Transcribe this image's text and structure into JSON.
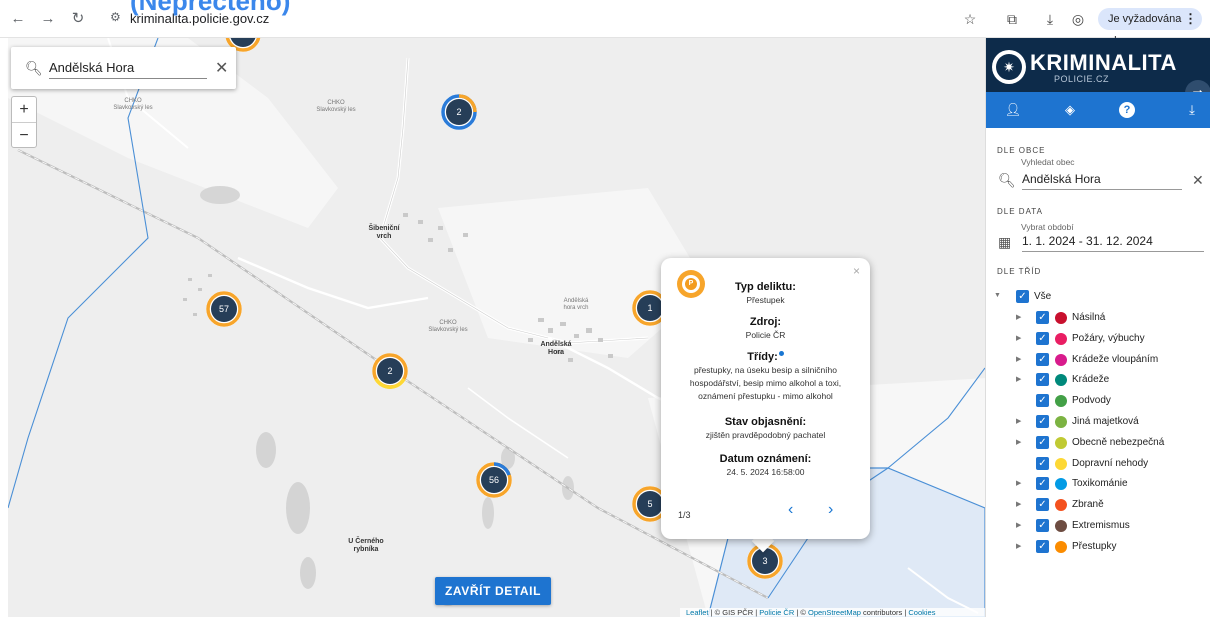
{
  "browser": {
    "url": "kriminalita.policie.gov.cz",
    "profile_chip": "Je vyžadována akce",
    "overlay_text": "(Nepřečteno)"
  },
  "map": {
    "search": {
      "value": "Andělská Hora",
      "placeholder": "Vyhledat obec"
    },
    "zoom_in": "+",
    "zoom_out": "−",
    "labels": {
      "chko_1": "CHKO Slavkovský les",
      "chko_2": "CHKO Slavkovský les",
      "chko_3": "CHKO Slavkovský les",
      "chko_4": "Andělská hora vrch",
      "sibenicni": "Šibeniční vrch",
      "andelska_hora": "Andělská Hora",
      "u_cerneho": "U Černého rybníka"
    },
    "clusters": [
      {
        "count": "2"
      },
      {
        "count": "57"
      },
      {
        "count": "2"
      },
      {
        "count": "1"
      },
      {
        "count": "56"
      },
      {
        "count": "5"
      },
      {
        "count": "3"
      }
    ],
    "close_detail": "ZAVŘÍT DETAIL",
    "attribution": {
      "leaflet": "Leaflet",
      "gis": "| © GIS PČR |",
      "policie": "Policie ČR",
      "osm_sep": "| ©",
      "osm": "OpenStreetMap",
      "contrib": "contributors |",
      "cookies": "Cookies"
    }
  },
  "popup": {
    "badge_letter": "P",
    "close": "×",
    "offense_heading": "Typ deliktu:",
    "offense_value": "Přestupek",
    "source_heading": "Zdroj:",
    "source_value": "Policie ČR",
    "classes_heading": "Třídy:",
    "classes_line1": "přestupky, na úseku besip a silničního",
    "classes_line2": "hospodářství, besip mimo alkohol a toxi,",
    "classes_line3": "oznámení přestupku - mimo alkohol",
    "status_heading": "Stav objasnění:",
    "status_value": "zjištěn pravděpodobný pachatel",
    "date_heading": "Datum oznámení:",
    "date_value": "24. 5. 2024 16:58:00",
    "pager": "1/3"
  },
  "sidebar": {
    "title": "KRIMINALITA",
    "subtitle": "POLICIE.CZ",
    "by_municipality": "DLE OBCE",
    "municipality_hint": "Vyhledat obec",
    "municipality_value": "Andělská Hora",
    "by_date": "DLE DATA",
    "date_hint": "Vybrat období",
    "date_value": "1. 1. 2024 - 31. 12. 2024",
    "by_classes": "DLE TŘÍD",
    "all_label": "Vše",
    "categories": [
      {
        "label": "Násilná",
        "color": "#c8102e",
        "expandable": true
      },
      {
        "label": "Požáry, výbuchy",
        "color": "#e91e63",
        "expandable": true
      },
      {
        "label": "Krádeže vloupáním",
        "color": "#d81b8c",
        "expandable": true
      },
      {
        "label": "Krádeže",
        "color": "#00897b",
        "expandable": true
      },
      {
        "label": "Podvody",
        "color": "#43a047",
        "expandable": false
      },
      {
        "label": "Jiná majetková",
        "color": "#7cb342",
        "expandable": true
      },
      {
        "label": "Obecně nebezpečná",
        "color": "#c0ca33",
        "expandable": true
      },
      {
        "label": "Dopravní nehody",
        "color": "#fdd835",
        "expandable": false
      },
      {
        "label": "Toxikománie",
        "color": "#039be5",
        "expandable": true
      },
      {
        "label": "Zbraně",
        "color": "#f4511e",
        "expandable": true
      },
      {
        "label": "Extremismus",
        "color": "#6d4c41",
        "expandable": true
      },
      {
        "label": "Přestupky",
        "color": "#fb8c00",
        "expandable": true
      }
    ]
  },
  "colors": {
    "accent_blue": "#1e74d0",
    "header_navy": "#0d2b4a",
    "cluster_core": "#263e58",
    "cluster_ring": "#f7a52b"
  }
}
